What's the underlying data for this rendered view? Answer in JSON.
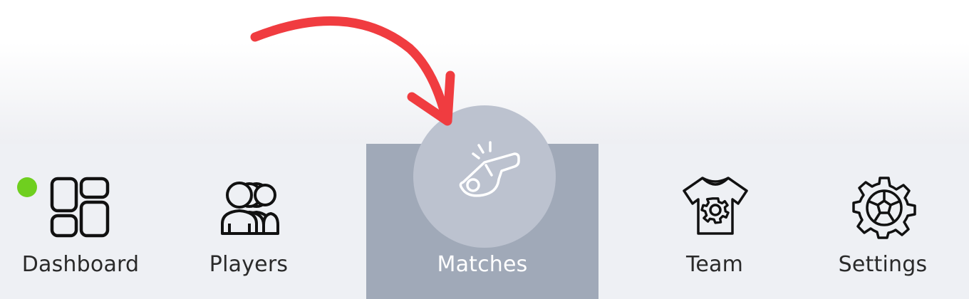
{
  "colors": {
    "active_bg": "#a0a9b8",
    "active_circle": "#bcc2cf",
    "nav_bg": "#eef0f4",
    "status_dot": "#6fcf1f",
    "arrow": "#f03c40",
    "icon_stroke": "#111111",
    "active_icon": "#ffffff"
  },
  "nav": {
    "items": [
      {
        "key": "dashboard",
        "label": "Dashboard",
        "icon": "dashboard-grid-icon",
        "active": false,
        "status": "online"
      },
      {
        "key": "players",
        "label": "Players",
        "icon": "players-group-icon",
        "active": false
      },
      {
        "key": "matches",
        "label": "Matches",
        "icon": "whistle-icon",
        "active": true
      },
      {
        "key": "team",
        "label": "Team",
        "icon": "team-jersey-icon",
        "active": false
      },
      {
        "key": "settings",
        "label": "Settings",
        "icon": "gear-ball-icon",
        "active": false
      }
    ]
  },
  "annotation": {
    "icon": "curved-arrow-icon",
    "target": "Matches"
  }
}
